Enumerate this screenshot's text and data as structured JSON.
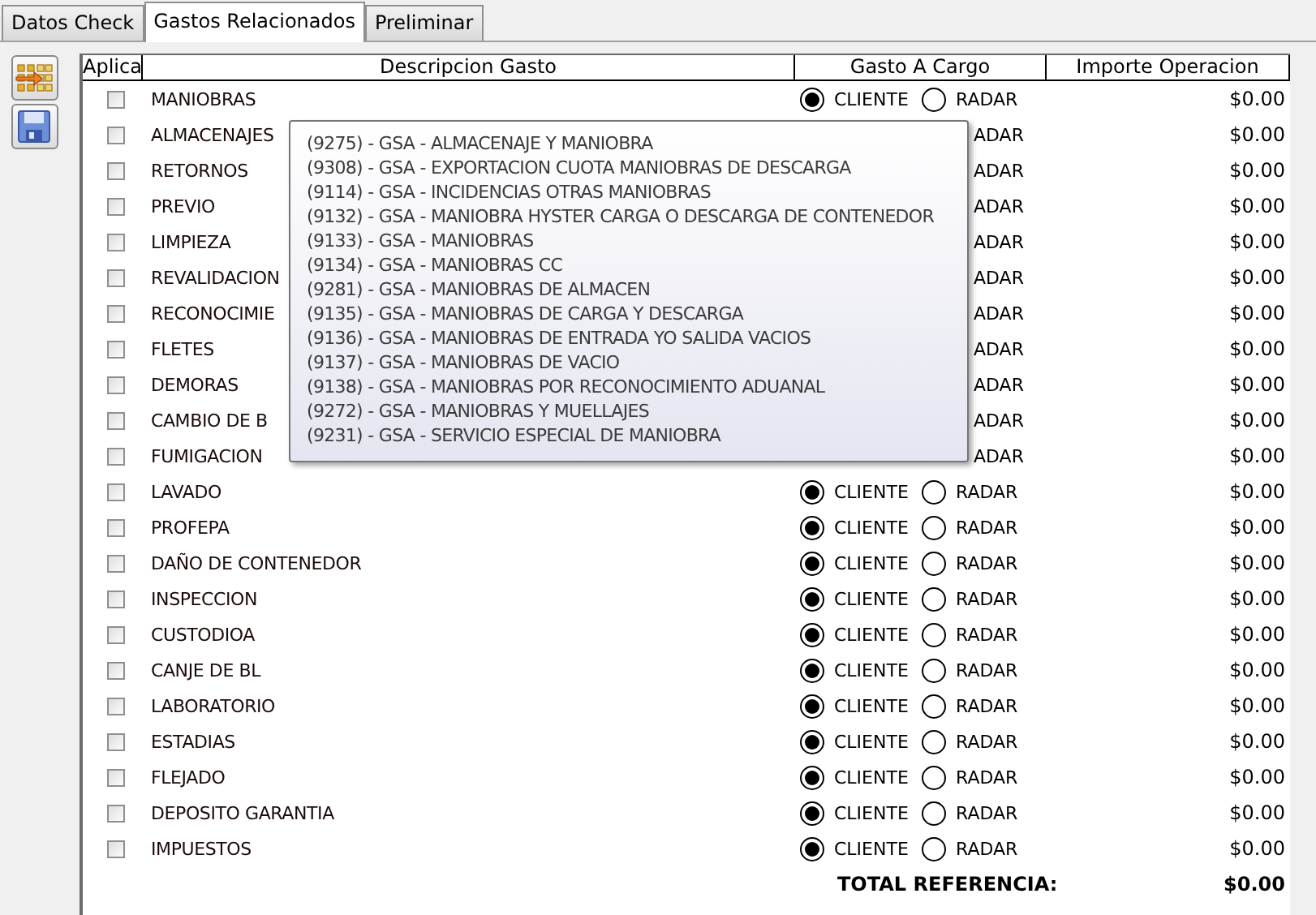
{
  "tabs": [
    {
      "label": "Datos Check",
      "selected": false
    },
    {
      "label": "Gastos Relacionados",
      "selected": true
    },
    {
      "label": "Preliminar",
      "selected": false
    }
  ],
  "toolbar_buttons": [
    {
      "kind": "transfer"
    },
    {
      "kind": "save"
    }
  ],
  "grid": {
    "columns": [
      "Aplica",
      "Descripcion Gasto",
      "Gasto A Cargo",
      "Importe Operacion"
    ],
    "rows": [
      {
        "aplica": false,
        "description": "MANIOBRAS",
        "cliente": {
          "label": "CLIENTE",
          "selected": true
        },
        "radar": {
          "label": "RADAR",
          "selected": false
        },
        "amount": "$0.00"
      },
      {
        "aplica": false,
        "description": "ALMACENAJES",
        "radar": {
          "label": "ADAR"
        },
        "amount": "$0.00"
      },
      {
        "aplica": false,
        "description": "RETORNOS",
        "radar": {
          "label": "ADAR"
        },
        "amount": "$0.00"
      },
      {
        "aplica": false,
        "description": "PREVIO",
        "radar": {
          "label": "ADAR"
        },
        "amount": "$0.00"
      },
      {
        "aplica": false,
        "description": "LIMPIEZA",
        "radar": {
          "label": "ADAR"
        },
        "amount": "$0.00"
      },
      {
        "aplica": false,
        "description": "REVALIDACION",
        "radar": {
          "label": "ADAR"
        },
        "amount": "$0.00"
      },
      {
        "aplica": false,
        "description": "RECONOCIMIE",
        "radar": {
          "label": "ADAR"
        },
        "amount": "$0.00"
      },
      {
        "aplica": false,
        "description": "FLETES",
        "radar": {
          "label": "ADAR"
        },
        "amount": "$0.00"
      },
      {
        "aplica": false,
        "description": "DEMORAS",
        "radar": {
          "label": "ADAR"
        },
        "amount": "$0.00"
      },
      {
        "aplica": false,
        "description": "CAMBIO DE B",
        "radar": {
          "label": "ADAR"
        },
        "amount": "$0.00"
      },
      {
        "aplica": false,
        "description": "FUMIGACION",
        "radar": {
          "label": "ADAR"
        },
        "amount": "$0.00"
      },
      {
        "aplica": false,
        "description": "LAVADO",
        "cliente": {
          "label": "CLIENTE",
          "selected": true
        },
        "radar": {
          "label": "RADAR",
          "selected": false
        },
        "amount": "$0.00"
      },
      {
        "aplica": false,
        "description": "PROFEPA",
        "cliente": {
          "label": "CLIENTE",
          "selected": true
        },
        "radar": {
          "label": "RADAR",
          "selected": false
        },
        "amount": "$0.00"
      },
      {
        "aplica": false,
        "description": "DAÑO DE CONTENEDOR",
        "cliente": {
          "label": "CLIENTE",
          "selected": true
        },
        "radar": {
          "label": "RADAR",
          "selected": false
        },
        "amount": "$0.00"
      },
      {
        "aplica": false,
        "description": "INSPECCION",
        "cliente": {
          "label": "CLIENTE",
          "selected": true
        },
        "radar": {
          "label": "RADAR",
          "selected": false
        },
        "amount": "$0.00"
      },
      {
        "aplica": false,
        "description": "CUSTODIOA",
        "cliente": {
          "label": "CLIENTE",
          "selected": true
        },
        "radar": {
          "label": "RADAR",
          "selected": false
        },
        "amount": "$0.00"
      },
      {
        "aplica": false,
        "description": "CANJE DE BL",
        "cliente": {
          "label": "CLIENTE",
          "selected": true
        },
        "radar": {
          "label": "RADAR",
          "selected": false
        },
        "amount": "$0.00"
      },
      {
        "aplica": false,
        "description": "LABORATORIO",
        "cliente": {
          "label": "CLIENTE",
          "selected": true
        },
        "radar": {
          "label": "RADAR",
          "selected": false
        },
        "amount": "$0.00"
      },
      {
        "aplica": false,
        "description": "ESTADIAS",
        "cliente": {
          "label": "CLIENTE",
          "selected": true
        },
        "radar": {
          "label": "RADAR",
          "selected": false
        },
        "amount": "$0.00"
      },
      {
        "aplica": false,
        "description": "FLEJADO",
        "cliente": {
          "label": "CLIENTE",
          "selected": true
        },
        "radar": {
          "label": "RADAR",
          "selected": false
        },
        "amount": "$0.00"
      },
      {
        "aplica": false,
        "description": "DEPOSITO GARANTIA",
        "cliente": {
          "label": "CLIENTE",
          "selected": true
        },
        "radar": {
          "label": "RADAR",
          "selected": false
        },
        "amount": "$0.00"
      },
      {
        "aplica": false,
        "description": "IMPUESTOS",
        "cliente": {
          "label": "CLIENTE",
          "selected": true
        },
        "radar": {
          "label": "RADAR",
          "selected": false
        },
        "amount": "$0.00"
      }
    ],
    "total": {
      "label": "TOTAL REFERENCIA:",
      "amount": "$0.00"
    }
  },
  "tooltip": {
    "items": [
      "(9275) - GSA - ALMACENAJE Y MANIOBRA",
      "(9308) - GSA - EXPORTACION CUOTA MANIOBRAS DE DESCARGA",
      "(9114) - GSA - INCIDENCIAS OTRAS MANIOBRAS",
      "(9132) - GSA - MANIOBRA HYSTER CARGA O DESCARGA DE CONTENEDOR",
      "(9133) - GSA - MANIOBRAS",
      "(9134) - GSA - MANIOBRAS CC",
      "(9281) - GSA - MANIOBRAS DE ALMACEN",
      "(9135) - GSA - MANIOBRAS DE CARGA Y DESCARGA",
      "(9136) - GSA - MANIOBRAS DE ENTRADA YO SALIDA VACIOS",
      "(9137) - GSA - MANIOBRAS DE VACIO",
      "(9138) - GSA - MANIOBRAS POR RECONOCIMIENTO ADUANAL",
      "(9272) - GSA - MANIOBRAS Y MUELLAJES",
      "(9231) - GSA - SERVICIO ESPECIAL DE MANIOBRA"
    ]
  }
}
